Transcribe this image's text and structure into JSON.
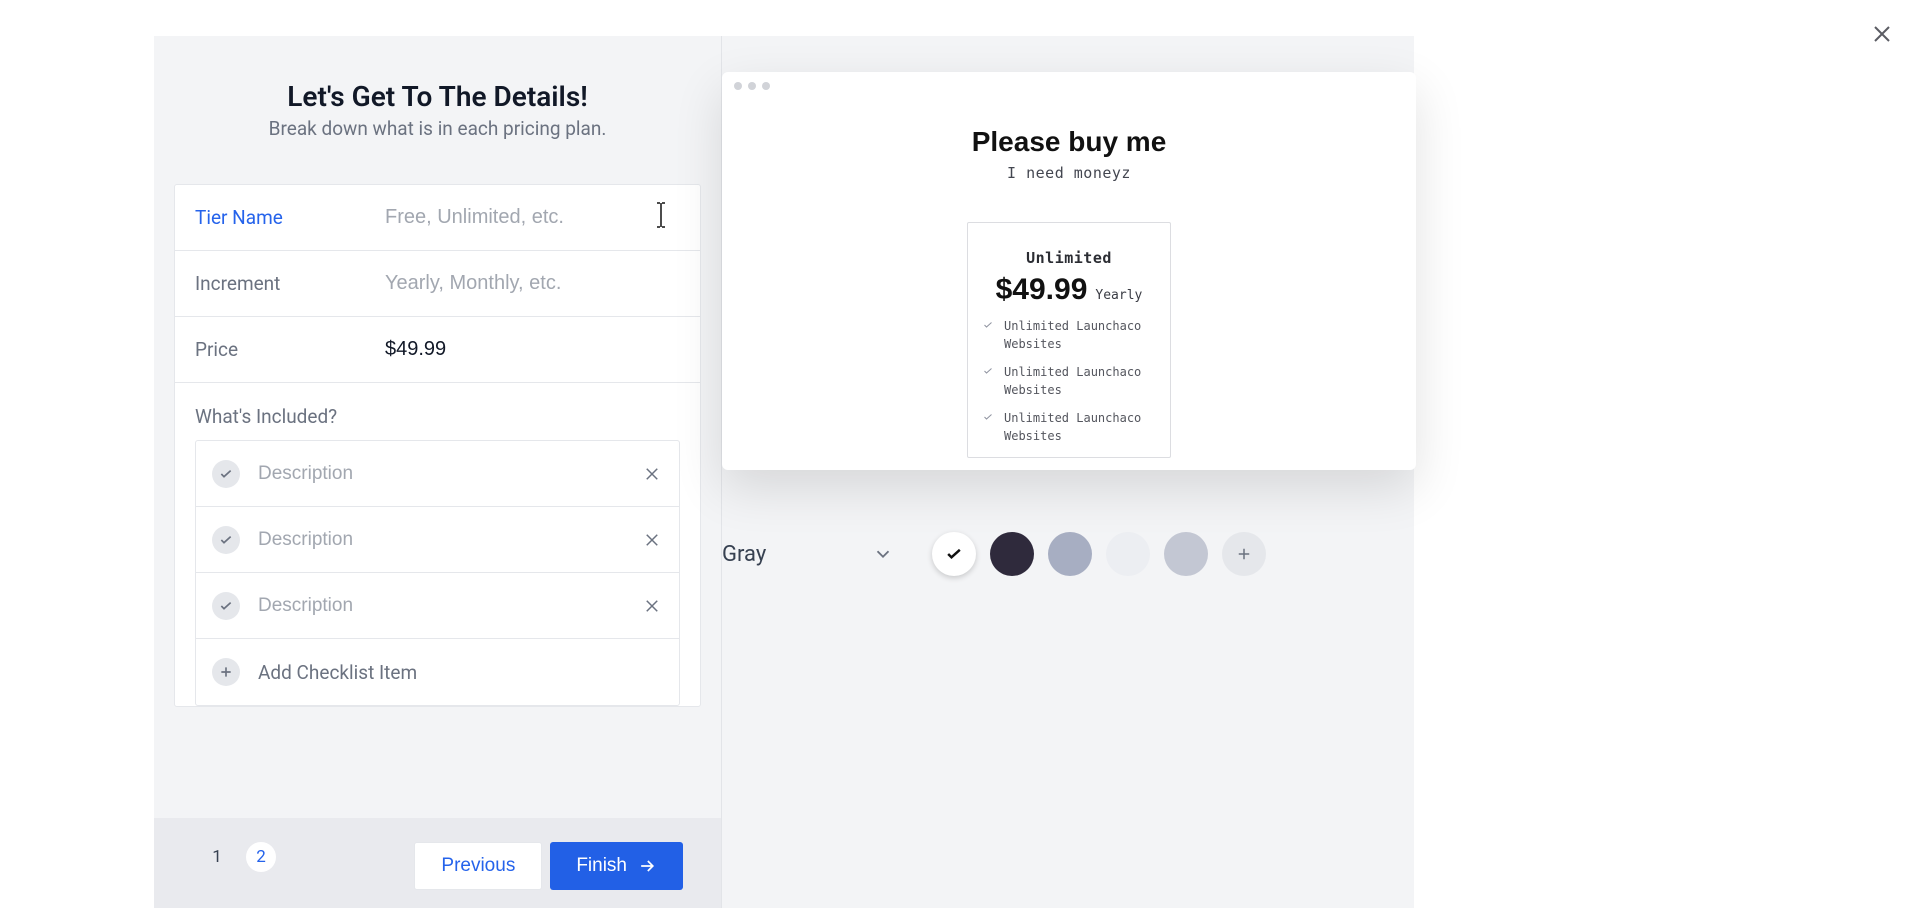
{
  "header": {
    "title": "Let's Get To The Details!",
    "subtitle": "Break down what is in each pricing plan."
  },
  "form": {
    "tier_name": {
      "label": "Tier Name",
      "placeholder": "Free, Unlimited, etc.",
      "value": ""
    },
    "increment": {
      "label": "Increment",
      "placeholder": "Yearly, Monthly, etc.",
      "value": ""
    },
    "price": {
      "label": "Price",
      "value": "$49.99"
    }
  },
  "included": {
    "label": "What's Included?",
    "items": [
      {
        "placeholder": "Description"
      },
      {
        "placeholder": "Description"
      },
      {
        "placeholder": "Description"
      }
    ],
    "add_label": "Add Checklist Item"
  },
  "footer": {
    "steps": [
      "1",
      "2"
    ],
    "active_step": 1,
    "previous": "Previous",
    "finish": "Finish"
  },
  "preview": {
    "title": "Please buy me",
    "subtitle": "I need moneyz",
    "plan": {
      "name": "Unlimited",
      "price": "$49.99",
      "period": "Yearly",
      "features": [
        "Unlimited Launchaco Websites",
        "Unlimited Launchaco Websites",
        "Unlimited Launchaco Websites"
      ]
    }
  },
  "palette": {
    "label": "Gray",
    "swatches": [
      {
        "color": "#ffffff",
        "selected": true
      },
      {
        "color": "#2f2a3c"
      },
      {
        "color": "#a7aec2"
      },
      {
        "color": "#eceef2"
      },
      {
        "color": "#c3c7d3"
      }
    ]
  }
}
